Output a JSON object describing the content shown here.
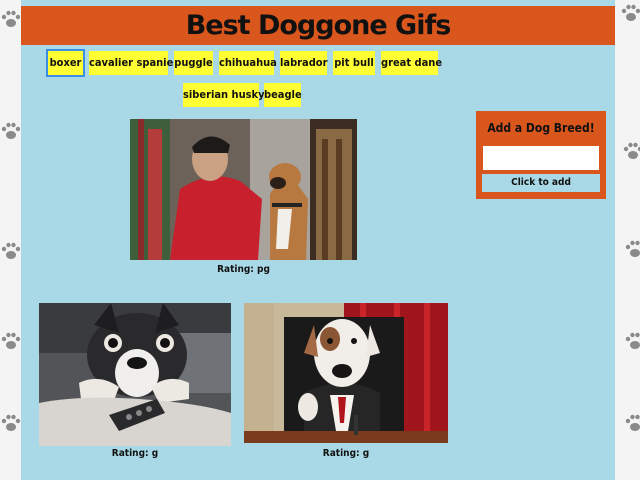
{
  "title": "Best Doggone Gifs",
  "breeds": [
    "boxer",
    "cavalier spaniel",
    "puggle",
    "chihuahua",
    "labrador",
    "pit bull",
    "great dane",
    "siberian husky",
    "beagle"
  ],
  "selected_breed": "boxer",
  "gifs": [
    {
      "rating_label": "Rating: pg"
    },
    {
      "rating_label": "Rating: g"
    },
    {
      "rating_label": "Rating: g"
    }
  ],
  "add_form": {
    "title": "Add a Dog Breed!",
    "input_value": "",
    "button_label": "Click to add"
  },
  "colors": {
    "header": "#d9561d",
    "panel": "#a9d9e6",
    "button": "#ffff33",
    "selected_outline": "#3a8ee6"
  }
}
